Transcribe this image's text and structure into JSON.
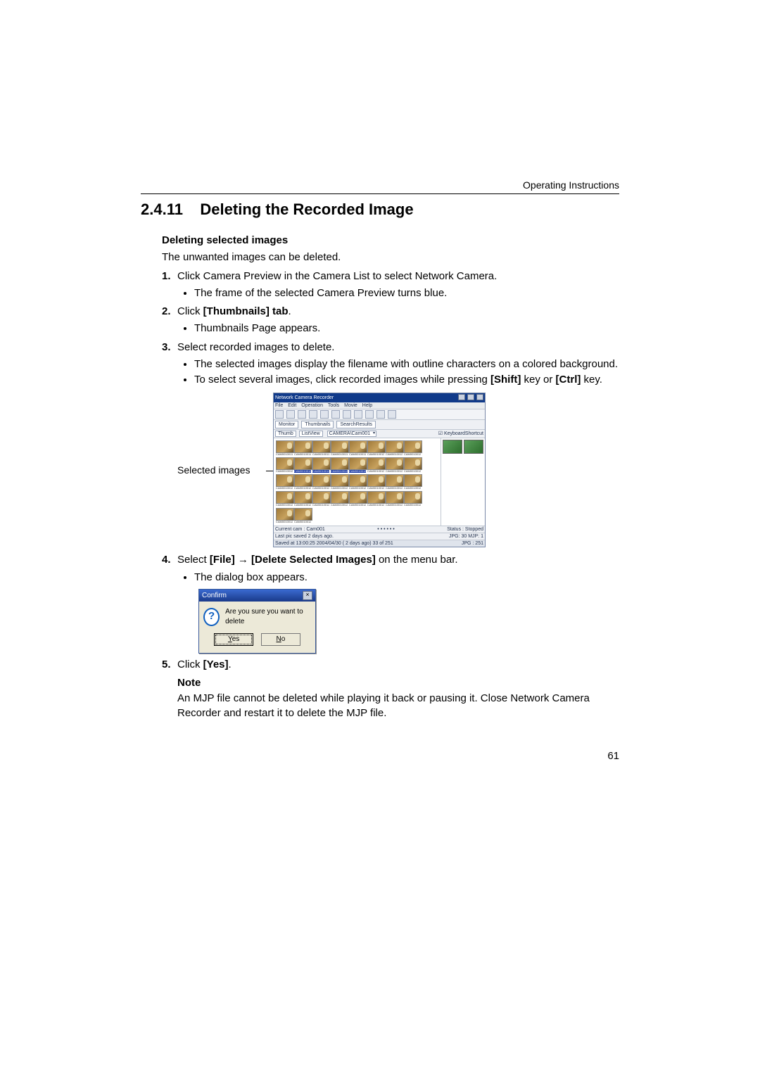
{
  "running_head": "Operating Instructions",
  "section": {
    "number": "2.4.11",
    "title": "Deleting the Recorded Image"
  },
  "sub": {
    "heading": "Deleting selected images",
    "intro": "The unwanted images can be deleted."
  },
  "steps": {
    "s1": {
      "text": "Click Camera Preview in the Camera List to select Network Camera.",
      "b1": "The frame of the selected Camera Preview turns blue."
    },
    "s2": {
      "text_pre": "Click ",
      "bold": "[Thumbnails] tab",
      "text_post": ".",
      "b1": "Thumbnails Page appears."
    },
    "s3": {
      "text": "Select recorded images to delete.",
      "b1": "The selected images display the filename with outline characters on a colored background.",
      "b2_pre": "To select several images, click recorded images while pressing ",
      "b2_k1": "[Shift]",
      "b2_mid": " key or ",
      "b2_k2": "[Ctrl]",
      "b2_post": " key."
    },
    "s4": {
      "pre": "Select ",
      "m1": "[File]",
      "arrow": " → ",
      "m2": "[Delete Selected Images]",
      "post": " on the menu bar.",
      "b1": "The dialog box appears."
    },
    "s5": {
      "pre": "Click ",
      "btn": "[Yes]",
      "post": "."
    }
  },
  "fig1": {
    "caption": "Selected images",
    "app_title": "Network Camera Recorder",
    "menu": {
      "file": "File",
      "edit": "Edit",
      "operation": "Operation",
      "tools": "Tools",
      "movie": "Movie",
      "help": "Help"
    },
    "tabs": {
      "monitor": "Monitor",
      "thumbnails": "Thumbnails",
      "search": "SearchResults"
    },
    "subbar": {
      "tab_thumb": "Thumb",
      "tab_listview": "ListView",
      "combo": "CAMERA\\Cam001",
      "chk": "KeyboardShortcut"
    },
    "labels": {
      "r1": [
        "CAM001001195",
        "CAM001001196",
        "CAM001001197",
        "CAM001001198",
        "CAM001001199",
        "CAM001001200",
        "CAM001001201",
        "CAM001001202",
        "CAM001001203"
      ],
      "r2": [
        "CAM001001204",
        "CAM001001205",
        "CAM001001206",
        "CAM001001207",
        "CAM001001208",
        "CAM001001209",
        "CAM001001210",
        "CAM001001211",
        "CAM001001212"
      ],
      "r3": [
        "CAM001001213",
        "CAM001001214",
        "CAM001001215",
        "CAM001001216",
        "CAM001001217",
        "CAM001001218",
        "CAM001001219",
        "CAM001001220",
        "CAM001001221"
      ],
      "r4": [
        "CAM001001222",
        "CAM001001223",
        "CAM001001224",
        "CAM001001225",
        "CAM001001226",
        "CAM001001227",
        "CAM001001228"
      ]
    },
    "sel_row": 1,
    "sel_cols": [
      0,
      1,
      2,
      3
    ],
    "status": {
      "cam": "Current cam : Cam001",
      "dots": "• • • • • •",
      "stat": "Status : Stopped",
      "last": "Last pic saved 2 days ago.",
      "fmt": "JPG: 30  MJP: 1",
      "foot_l": "Saved at 13:00:25 2004/04/30 ( 2 days ago) 33 of 251",
      "foot_r": "JPG : 251"
    }
  },
  "dialog": {
    "title": "Confirm",
    "msg": "Are you sure you want to delete",
    "yes_u": "Y",
    "yes_r": "es",
    "no_u": "N",
    "no_r": "o"
  },
  "note": {
    "label": "Note",
    "text": "An MJP file cannot be deleted while playing it back or pausing it. Close Network Camera Recorder and restart it to delete the MJP file."
  },
  "page_number": "61"
}
